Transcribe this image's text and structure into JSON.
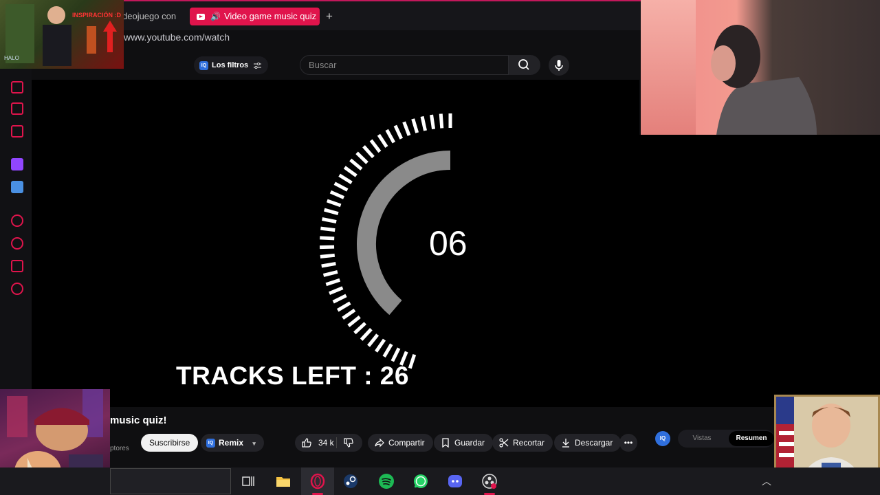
{
  "browser": {
    "tabs": [
      {
        "label": "deojuego con"
      },
      {
        "label": "Video game music quiz"
      }
    ],
    "new_tab_label": "+",
    "url": "www.youtube.com/watch"
  },
  "youtube": {
    "filters_label": "Los filtros",
    "search_placeholder": "Buscar",
    "iq_badge": "IQ"
  },
  "video": {
    "countdown": "06",
    "tracks_left": "TRACKS LEFT : 26",
    "timer_fraction_remaining": 0.45,
    "title_fragment": "music quiz!",
    "subs_fragment": "ptores"
  },
  "actions": {
    "subscribe": "Suscribirse",
    "remix": "Remix",
    "likes": "34 k",
    "share": "Compartir",
    "save": "Guardar",
    "clip": "Recortar",
    "download": "Descargar",
    "more": "•••"
  },
  "side_panel": {
    "iq": "IQ",
    "tab_views": "Vistas",
    "tab_summary": "Resumen"
  },
  "overlays": {
    "thumb_label": "INSPIRACIÓN :D",
    "thumb_halo": "HALO"
  },
  "colors": {
    "accent": "#e0144c",
    "background": "#0f0f11"
  }
}
